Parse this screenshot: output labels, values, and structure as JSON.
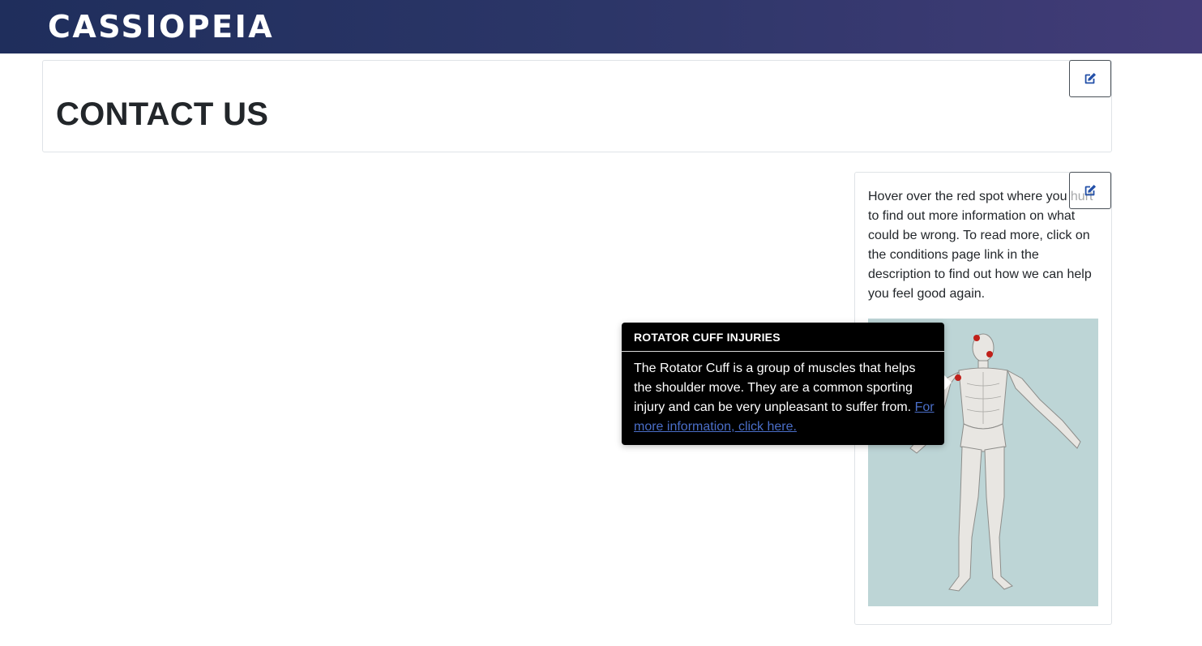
{
  "header": {
    "brand": "CASSIOPEIA"
  },
  "title_card": {
    "title": "CONTACT US"
  },
  "side_card": {
    "text": "Hover over the red spot where you hurt to find out more information on what could be wrong. To read more, click on the conditions page link in the description to find out how we can help you feel good again.",
    "image_icon": "human-anatomy-figure"
  },
  "tooltip": {
    "title": "ROTATOR CUFF INJURIES",
    "body": "The Rotator Cuff is a group of muscles that helps the shoulder move. They are a common sporting injury and can be very unpleasant to suffer from. ",
    "link_text": "For more information, click here."
  },
  "icons": {
    "edit": "edit-icon"
  },
  "colors": {
    "header_start": "#1f2e5c",
    "header_end": "#433c78",
    "hotspot": "#c0201a",
    "image_bg": "#bdd5d6",
    "link": "#4a6ec8"
  }
}
